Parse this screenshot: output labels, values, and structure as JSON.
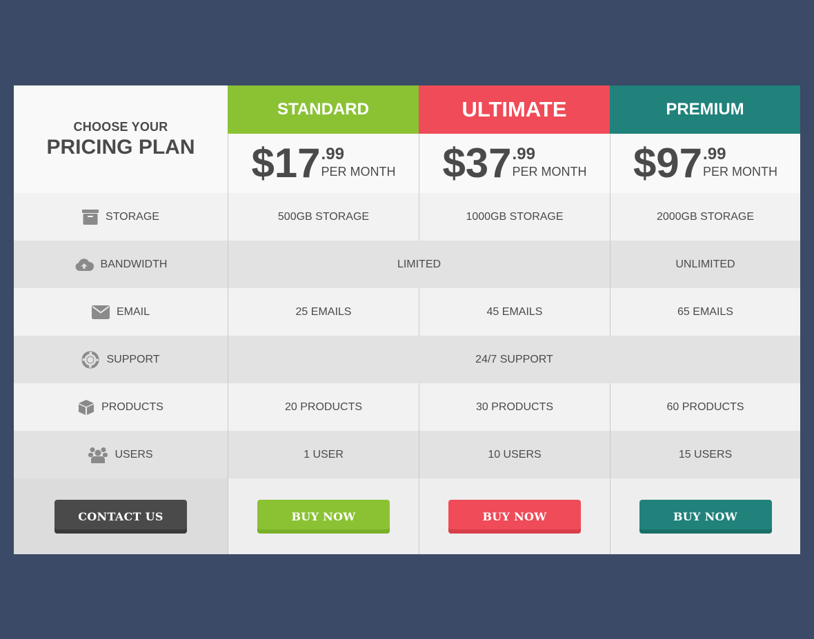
{
  "header": {
    "line1": "CHOOSE YOUR",
    "line2": "PRICING PLAN"
  },
  "plans": [
    {
      "name": "STANDARD",
      "color": "#8bc234",
      "shade": "#7ab029",
      "price": "$17",
      "cents": ".99",
      "period": "PER MONTH",
      "button": "BUY NOW"
    },
    {
      "name": "ULTIMATE",
      "color": "#ef4b58",
      "shade": "#d93e4b",
      "price": "$37",
      "cents": ".99",
      "period": "PER MONTH",
      "button": "BUY NOW"
    },
    {
      "name": "PREMIUM",
      "color": "#20827b",
      "shade": "#1a6f69",
      "price": "$97",
      "cents": ".99",
      "period": "PER MONTH",
      "button": "BUY NOW"
    }
  ],
  "features": {
    "storage": {
      "label": "STORAGE",
      "icon": "archive-icon",
      "values": [
        "500GB STORAGE",
        "1000GB STORAGE",
        "2000GB STORAGE"
      ]
    },
    "bandwidth": {
      "label": "BANDWIDTH",
      "icon": "cloud-upload-icon",
      "values": [
        "LIMITED",
        "UNLIMITED"
      ]
    },
    "email": {
      "label": "EMAIL",
      "icon": "envelope-icon",
      "values": [
        "25 EMAILS",
        "45 EMAILS",
        "65 EMAILS"
      ]
    },
    "support": {
      "label": "SUPPORT",
      "icon": "lifebuoy-icon",
      "values": [
        "24/7 SUPPORT"
      ]
    },
    "products": {
      "label": "PRODUCTS",
      "icon": "cube-icon",
      "values": [
        "20 PRODUCTS",
        "30 PRODUCTS",
        "60 PRODUCTS"
      ]
    },
    "users": {
      "label": "USERS",
      "icon": "users-icon",
      "values": [
        "1 USER",
        "10 USERS",
        "15 USERS"
      ]
    }
  },
  "contact_button": "CONTACT US",
  "colors": {
    "background": "#3b4a66",
    "contact_button": "#4a4a4a",
    "text": "#4a4a4a",
    "icon": "#8a8a8a"
  }
}
